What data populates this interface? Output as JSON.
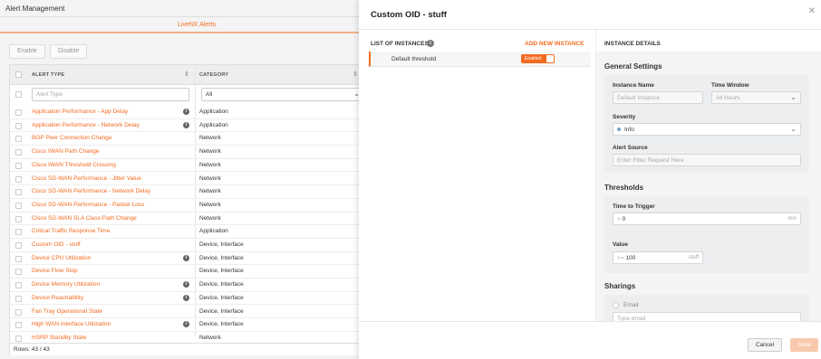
{
  "app": {
    "title": "Alert Management"
  },
  "tabs": {
    "livenx": "LiveNX Alerts"
  },
  "toolbar": {
    "enable": "Enable",
    "disable": "Disable"
  },
  "grid": {
    "columns": {
      "alert_type": "ALERT TYPE",
      "category": "CATEGORY"
    },
    "filter": {
      "alert_type_placeholder": "Alert Type",
      "category_value": "All"
    },
    "rows": [
      {
        "name": "Application Performance - App Delay",
        "category": "Application",
        "info": true
      },
      {
        "name": "Application Performance - Network Delay",
        "category": "Application",
        "info": true
      },
      {
        "name": "BGP Peer Connection Change",
        "category": "Network",
        "info": false
      },
      {
        "name": "Cisco IWAN Path Change",
        "category": "Network",
        "info": false
      },
      {
        "name": "Cisco IWAN Threshold Crossing",
        "category": "Network",
        "info": false
      },
      {
        "name": "Cisco SD-WAN Performance - Jitter Value",
        "category": "Network",
        "info": false
      },
      {
        "name": "Cisco SD-WAN Performance - Network Delay",
        "category": "Network",
        "info": false
      },
      {
        "name": "Cisco SD-WAN Performance - Packet Loss",
        "category": "Network",
        "info": false
      },
      {
        "name": "Cisco SD-WAN SLA Class Path Change",
        "category": "Network",
        "info": false
      },
      {
        "name": "Critical Traffic Response Time",
        "category": "Application",
        "info": false
      },
      {
        "name": "Custom OID - stuff",
        "category": "Device, Interface",
        "info": false
      },
      {
        "name": "Device CPU Utilization",
        "category": "Device, Interface",
        "info": true
      },
      {
        "name": "Device Flow Stop",
        "category": "Device, Interface",
        "info": false
      },
      {
        "name": "Device Memory Utilization",
        "category": "Device, Interface",
        "info": true
      },
      {
        "name": "Device Reachability",
        "category": "Device, Interface",
        "info": true
      },
      {
        "name": "Fan Tray Operational State",
        "category": "Device, Interface",
        "info": false
      },
      {
        "name": "High WAN Interface Utilization",
        "category": "Device, Interface",
        "info": true
      },
      {
        "name": "HSRP Standby State",
        "category": "Network",
        "info": false
      }
    ],
    "footer": "Rows: 43 / 43"
  },
  "modal": {
    "title": "Custom OID - stuff",
    "list_heading": "LIST OF INSTANCES",
    "add_new": "ADD NEW INSTANCE",
    "instance": {
      "name": "Default threshold",
      "toggle_label": "Enabled",
      "enabled": true
    },
    "details_heading": "INSTANCE DETAILS",
    "general": {
      "title": "General Settings",
      "instance_name_label": "Instance Name",
      "instance_name_placeholder": "Default Instance",
      "time_window_label": "Time Window",
      "time_window_value": "All Hours",
      "severity_label": "Severity",
      "severity_value": "Info",
      "alert_source_label": "Alert Source",
      "alert_source_placeholder": "Enter Filter Request Here"
    },
    "thresholds": {
      "title": "Thresholds",
      "time_label": "Time to Trigger",
      "time_prefix": ">",
      "time_value": "0",
      "time_unit": "min",
      "value_label": "Value",
      "value_prefix": ">=",
      "value_value": "100",
      "value_unit": "stuff"
    },
    "sharings": {
      "title": "Sharings",
      "email_label": "Email",
      "email_placeholder": "Type email"
    },
    "buttons": {
      "cancel": "Cancel",
      "save": "Save"
    }
  },
  "colors": {
    "accent": "#f26b21",
    "accent_disabled": "#f8c9ad",
    "severity_info": "#7a9ccb"
  }
}
